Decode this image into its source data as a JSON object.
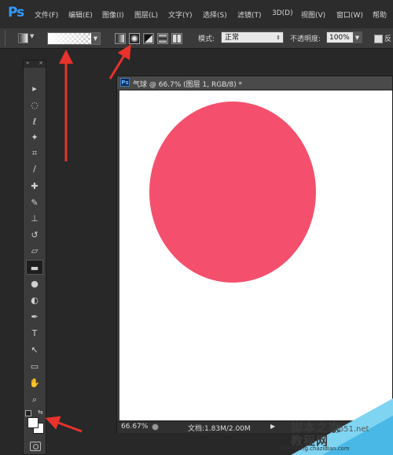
{
  "app": {
    "logo": "Ps"
  },
  "menu": [
    {
      "label": "文件(F)"
    },
    {
      "label": "编辑(E)"
    },
    {
      "label": "图像(I)"
    },
    {
      "label": "图层(L)"
    },
    {
      "label": "文字(Y)"
    },
    {
      "label": "选择(S)"
    },
    {
      "label": "滤镜(T)"
    },
    {
      "label": "3D(D)"
    },
    {
      "label": "视图(V)"
    },
    {
      "label": "窗口(W)"
    },
    {
      "label": "帮助"
    }
  ],
  "options": {
    "mode_label": "模式:",
    "mode_value": "正常",
    "opacity_label": "不透明度:",
    "opacity_value": "100%",
    "reverse_label": "反",
    "gradient_types": [
      "linear-gradient-icon",
      "radial-gradient-icon",
      "angle-gradient-icon",
      "reflected-gradient-icon",
      "diamond-gradient-icon"
    ],
    "selected_gradient_type": "radial-gradient-icon"
  },
  "toolbox": {
    "tools": [
      {
        "icon": "move-tool-icon",
        "glyph": "▸"
      },
      {
        "icon": "marquee-tool-icon",
        "glyph": "◌"
      },
      {
        "icon": "lasso-tool-icon",
        "glyph": "ℓ"
      },
      {
        "icon": "magic-wand-tool-icon",
        "glyph": "✦"
      },
      {
        "icon": "crop-tool-icon",
        "glyph": "⌗"
      },
      {
        "icon": "eyedropper-tool-icon",
        "glyph": "/"
      },
      {
        "icon": "healing-brush-tool-icon",
        "glyph": "✚"
      },
      {
        "icon": "brush-tool-icon",
        "glyph": "✎"
      },
      {
        "icon": "clone-stamp-tool-icon",
        "glyph": "⊥"
      },
      {
        "icon": "history-brush-tool-icon",
        "glyph": "↺"
      },
      {
        "icon": "eraser-tool-icon",
        "glyph": "▱"
      },
      {
        "icon": "gradient-tool-icon",
        "glyph": "▬"
      },
      {
        "icon": "blur-tool-icon",
        "glyph": "●"
      },
      {
        "icon": "dodge-tool-icon",
        "glyph": "◐"
      },
      {
        "icon": "pen-tool-icon",
        "glyph": "✒"
      },
      {
        "icon": "type-tool-icon",
        "glyph": "T"
      },
      {
        "icon": "path-selection-tool-icon",
        "glyph": "↖"
      },
      {
        "icon": "shape-tool-icon",
        "glyph": "▭"
      },
      {
        "icon": "hand-tool-icon",
        "glyph": "✋"
      },
      {
        "icon": "zoom-tool-icon",
        "glyph": "⌕"
      }
    ],
    "active_tool": "gradient-tool-icon",
    "foreground_color": "#ffffff",
    "background_color": "#ffffff"
  },
  "document": {
    "ps_badge": "Ps",
    "title": "气球 @ 66.7% (图层 1, RGB/8) *",
    "zoom": "66.67%",
    "doc_info": "文档:1.83M/2.00M",
    "shape_color": "#f4506e",
    "canvas_color": "#ffffff"
  },
  "watermark": {
    "line1": "脚本之家",
    "line1b": "jb51.net",
    "line2": "教程网",
    "line3": "jiaocheng.chazidian.com"
  },
  "colors": {
    "annotation_arrow": "#e8322b",
    "accent": "#2f9bff"
  }
}
